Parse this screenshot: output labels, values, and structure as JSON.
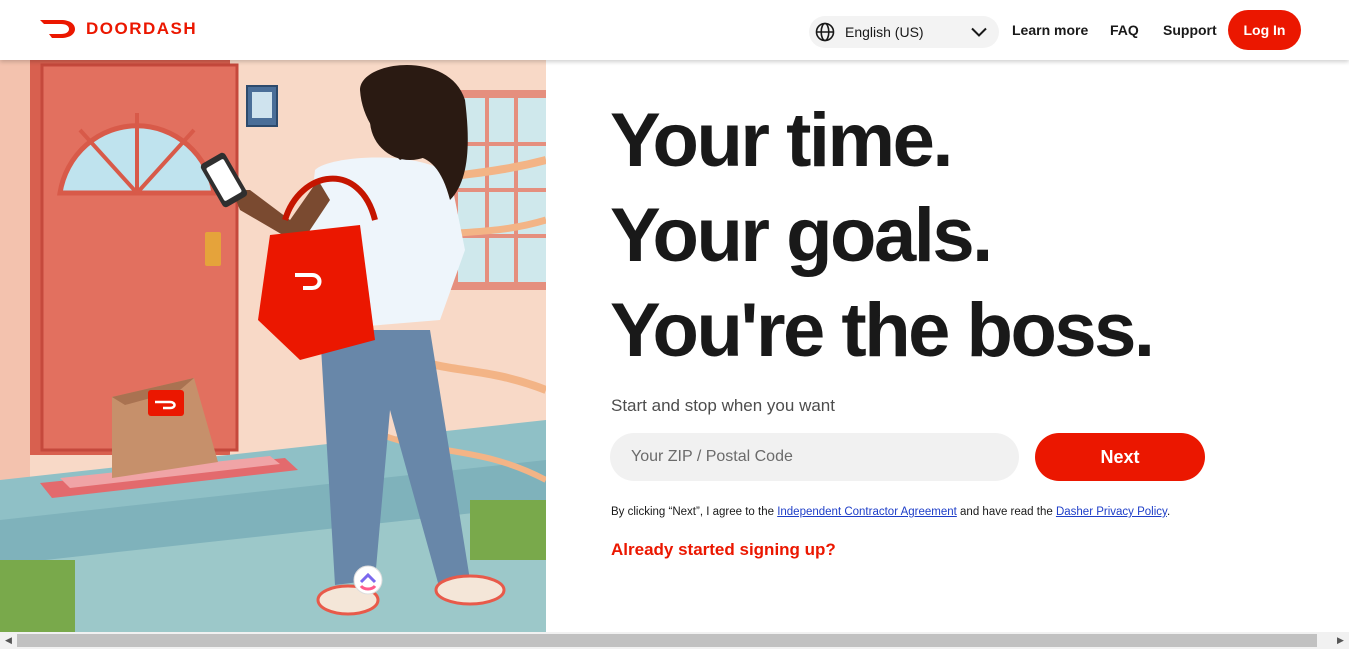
{
  "header": {
    "logo_text": "DOORDASH",
    "language": "English (US)",
    "nav": {
      "learn_more": "Learn more",
      "faq": "FAQ",
      "support": "Support"
    },
    "login_label": "Log In"
  },
  "hero": {
    "headline_1": "Your time.",
    "headline_2": "Your goals.",
    "headline_3": "You're the boss.",
    "subheading": "Start and stop when you want",
    "zip_placeholder": "Your ZIP / Postal Code",
    "zip_value": "",
    "next_label": "Next",
    "legal_prefix": "By clicking “Next”, I agree to the ",
    "legal_link_1": "Independent Contractor Agreement",
    "legal_middle": " and have read the ",
    "legal_link_2": "Dasher Privacy Policy",
    "legal_suffix": ".",
    "already_signing_up": "Already started signing up?"
  },
  "colors": {
    "brand": "#eb1700",
    "link": "#1e3ec8",
    "text": "#191919"
  },
  "icons": {
    "logo": "doordash-logo-icon",
    "language": "globe-icon",
    "dropdown": "chevron-down-icon"
  }
}
